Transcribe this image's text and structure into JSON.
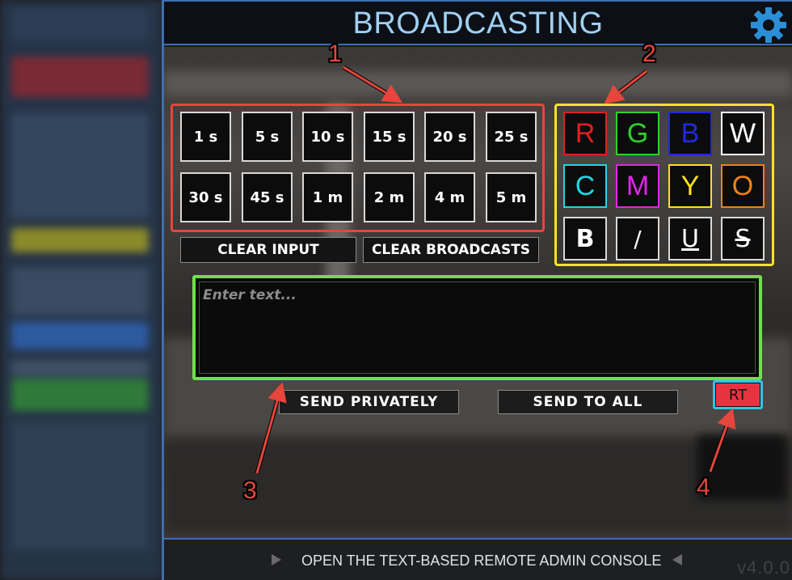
{
  "header": {
    "title": "BROADCASTING",
    "settings_icon": "gear-icon"
  },
  "time_buttons": [
    "1 s",
    "5 s",
    "10 s",
    "15 s",
    "20 s",
    "25 s",
    "30 s",
    "45 s",
    "1 m",
    "2 m",
    "4 m",
    "5 m"
  ],
  "clear_buttons": {
    "clear_input": "CLEAR INPUT",
    "clear_broadcasts": "CLEAR BROADCASTS"
  },
  "color_buttons": [
    {
      "label": "R",
      "color": "#e02020"
    },
    {
      "label": "G",
      "color": "#2ed12e"
    },
    {
      "label": "B",
      "color": "#2228e0"
    },
    {
      "label": "W",
      "color": "#ffffff"
    },
    {
      "label": "C",
      "color": "#1fd6e0"
    },
    {
      "label": "M",
      "color": "#e026e8"
    },
    {
      "label": "Y",
      "color": "#ffe020"
    },
    {
      "label": "O",
      "color": "#f08018"
    }
  ],
  "style_buttons": [
    {
      "label": "B",
      "style": "bold"
    },
    {
      "label": "/",
      "style": "italic"
    },
    {
      "label": "U",
      "style": "underline"
    },
    {
      "label": "S",
      "style": "strikethrough"
    }
  ],
  "text_input": {
    "placeholder": "Enter text...",
    "value": ""
  },
  "send_buttons": {
    "send_privately": "SEND PRIVATELY",
    "send_to_all": "SEND TO ALL"
  },
  "rt_button": {
    "label": "RT"
  },
  "footer": {
    "link": "OPEN THE TEXT-BASED REMOTE ADMIN CONSOLE",
    "version": "v4.0.0"
  },
  "annotations": [
    "1",
    "2",
    "3",
    "4"
  ],
  "annotation_color": "#e6463c"
}
